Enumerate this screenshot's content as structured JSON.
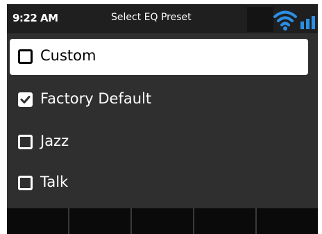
{
  "status_bar": {
    "time": "9:22 AM",
    "title": "Select EQ Preset",
    "wifi_icon": "wifi-icon",
    "signal_icon": "signal-bars-icon",
    "accent_color": "#2b8fe6"
  },
  "presets": [
    {
      "label": "Custom",
      "checked": false,
      "highlighted": true
    },
    {
      "label": "Factory Default",
      "checked": true,
      "highlighted": false
    },
    {
      "label": "Jazz",
      "checked": false,
      "highlighted": false
    },
    {
      "label": "Talk",
      "checked": false,
      "highlighted": false
    }
  ],
  "softkeys": [
    "",
    "",
    "",
    "",
    ""
  ]
}
